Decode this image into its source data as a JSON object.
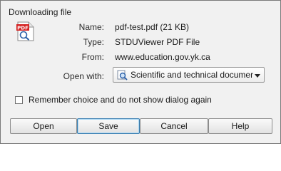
{
  "dialog": {
    "title": "Downloading file",
    "file_icon": "pdf-file-icon"
  },
  "details": {
    "name_label": "Name:",
    "name_value": "pdf-test.pdf (21 KB)",
    "type_label": "Type:",
    "type_value": "STDUViewer PDF File",
    "from_label": "From:",
    "from_value": "www.education.gov.yk.ca",
    "open_with_label": "Open with:",
    "open_with_value": "Scientific and technical documer",
    "open_with_icon": "magnifier-app-icon"
  },
  "remember": {
    "label": "Remember choice and do not show dialog again",
    "checked": false
  },
  "buttons": {
    "open": "Open",
    "save": "Save",
    "cancel": "Cancel",
    "help": "Help"
  }
}
